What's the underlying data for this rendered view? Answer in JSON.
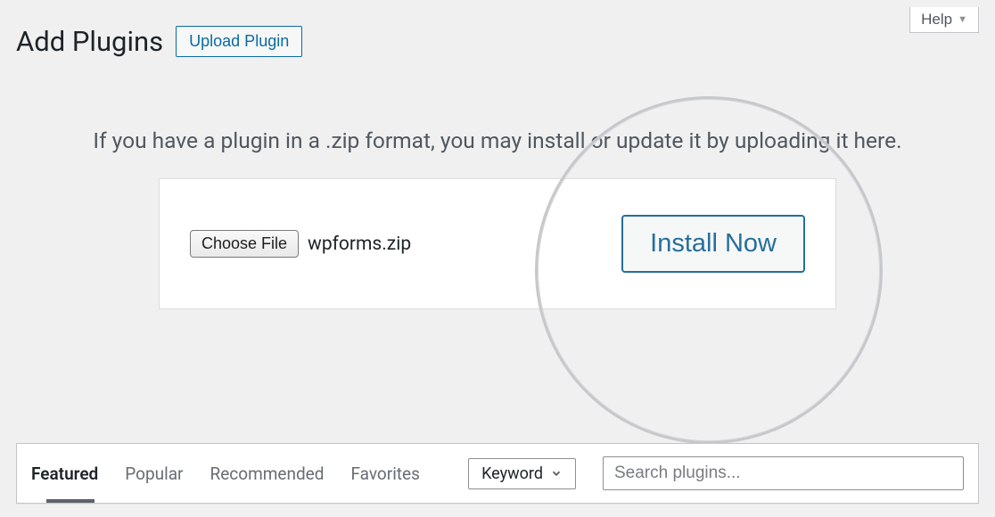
{
  "help": {
    "label": "Help"
  },
  "header": {
    "title": "Add Plugins",
    "upload_label": "Upload Plugin"
  },
  "upload": {
    "instruction": "If you have a plugin in a .zip format, you may install or update it by uploading it here.",
    "choose_file_label": "Choose File",
    "filename": "wpforms.zip",
    "install_label": "Install Now"
  },
  "filters": {
    "tabs": [
      {
        "label": "Featured"
      },
      {
        "label": "Popular"
      },
      {
        "label": "Recommended"
      },
      {
        "label": "Favorites"
      }
    ],
    "keyword_label": "Keyword",
    "search_placeholder": "Search plugins..."
  }
}
